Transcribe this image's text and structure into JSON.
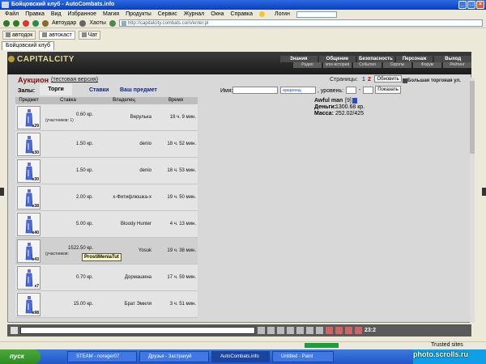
{
  "window": {
    "title": "Бойцовский клуб - AutoCombats.info",
    "controls": [
      "_",
      "□",
      "×"
    ]
  },
  "menu": {
    "items": [
      "Файл",
      "Правка",
      "Вид",
      "Избранное",
      "Магия",
      "Продукты",
      "Сервис",
      "Журнал",
      "Окна",
      "Справка"
    ],
    "login_label": "Логин"
  },
  "toolbar": {
    "autodar": "Автоудар",
    "chaos": "Хаоты",
    "url": "http://capitalcity.combats.com/enter.pl"
  },
  "quickbar": {
    "items": [
      "автодок",
      "автокаст",
      "Чат"
    ]
  },
  "browser_tab": "Бойцовский клуб",
  "game": {
    "logo": "CAPITALCITY",
    "nav_top": [
      "Знания",
      "Общение",
      "Безопасность",
      "Персонаж",
      "Выход"
    ],
    "nav_bottom": [
      "Радио",
      "sms-история",
      "События",
      "Скролы",
      "Форум",
      "Рейтинг"
    ]
  },
  "auction": {
    "title": "Аукцион",
    "subtitle": "(тестовая версия)",
    "pages_label": "Страницы:",
    "pages": [
      "1",
      "2"
    ],
    "refresh": "Обновить",
    "trade_label": "Большая торговая ул.",
    "halls_label": "Залы:",
    "tabs": [
      "Торги",
      "Ставки",
      "Ваш предмет"
    ],
    "name_label": "Имя:",
    "filter_value": "аукционщ",
    "level_label": ", уровень:",
    "level_dash": "-",
    "show_btn": "Показать",
    "columns": [
      "Предмет",
      "Ставка",
      "Владелец",
      "Время"
    ],
    "rows": [
      {
        "qty": "x29",
        "price": "0.60 кр.",
        "bids": "(участников: 1)",
        "owner": "Верулька",
        "time": "18 ч. 9 мин."
      },
      {
        "qty": "x30",
        "price": "1.50 кр.",
        "bids": "",
        "owner": "denio",
        "time": "18 ч. 52 мин."
      },
      {
        "qty": "x30",
        "price": "1.50 кр.",
        "bids": "",
        "owner": "denio",
        "time": "18 ч. 53 мин."
      },
      {
        "qty": "x38",
        "price": "2.00 кр.",
        "bids": "",
        "owner": "x-Фитифлюшка-x",
        "time": "19 ч. 50 мин."
      },
      {
        "qty": "x40",
        "price": "5.00 кр.",
        "bids": "",
        "owner": "Bloody Hunter",
        "time": "4 ч. 13 мин."
      },
      {
        "qty": "x43",
        "price": "1522.50 кр.",
        "bids": "(участников:",
        "owner": "Yosuk",
        "time": "19 ч. 38 мин."
      },
      {
        "qty": "x7",
        "price": "0.70 кр.",
        "bids": "",
        "owner": "Дормашина",
        "time": "17 ч. 59 мин."
      },
      {
        "qty": "x98",
        "price": "15.00 кр.",
        "bids": "",
        "owner": "Брат Эмиля",
        "time": "3 ч. 51 мин."
      }
    ],
    "tooltip": "ProstiMeniaTut"
  },
  "player": {
    "name": "Awful man",
    "level": "[9]",
    "money_label": "Деньги:",
    "money": "1300.68 кр.",
    "mass_label": "Масса:",
    "mass": "252.02/425"
  },
  "gamebar": {
    "clock": "23:2"
  },
  "statusbar": {
    "trusted": "Trusted sites"
  },
  "taskbar": {
    "start": "пуск",
    "tasks": [
      "STEAM - norager07",
      "Друзья - Застрахуй",
      "AutoCombats.info",
      "Untitled - Paint"
    ],
    "watermark": "photo.scrolls.ru"
  },
  "colors": {
    "accent_title": "#7a1010",
    "link": "#0a2a8a",
    "xp_blue": "#2256c8"
  }
}
